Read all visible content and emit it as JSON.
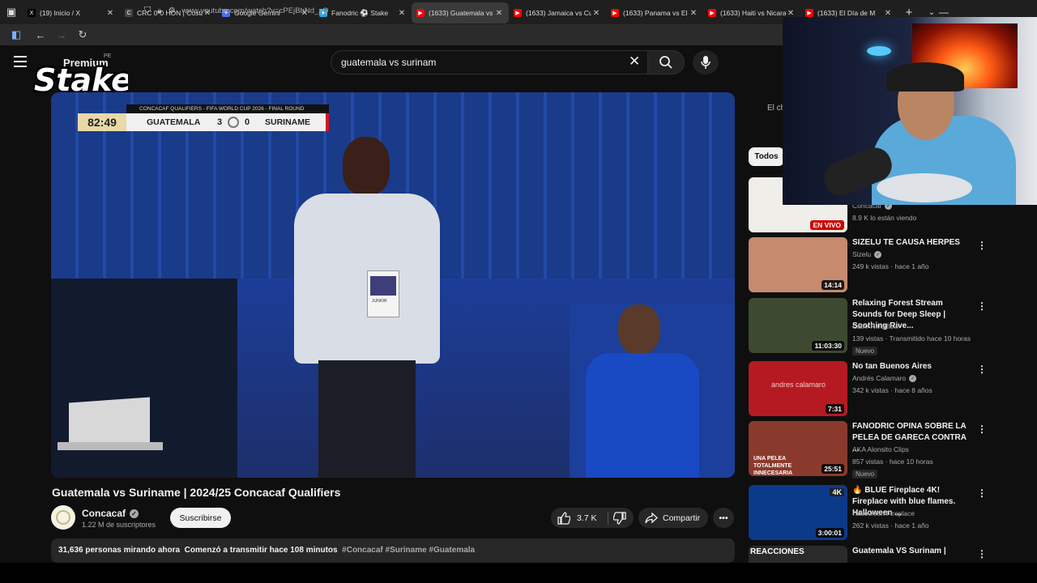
{
  "browser": {
    "tabs": [
      {
        "label": "(19) Inicio / X",
        "fav": "x-logo",
        "active": false
      },
      {
        "label": "CRC 0-0 HON | Costa R",
        "fav": "site",
        "active": false
      },
      {
        "label": "Google Gemini",
        "fav": "gemini",
        "active": false
      },
      {
        "label": "Fanodric ⚽ Stake",
        "fav": "telegram",
        "active": false
      },
      {
        "label": "(1633) Guatemala vs S",
        "fav": "youtube",
        "active": true
      },
      {
        "label": "(1633) Jamaica vs Cura",
        "fav": "youtube",
        "active": false
      },
      {
        "label": "(1633) Panama vs El Sa",
        "fav": "youtube",
        "active": false
      },
      {
        "label": "(1633) Haiti vs Nicarag",
        "fav": "youtube",
        "active": false
      },
      {
        "label": "(1633) El Día de M",
        "fav": "youtube",
        "active": false
      }
    ],
    "new_tab": "+",
    "url": "www.youtube.com/watch?v=cPEjBbNd_zQ"
  },
  "header": {
    "logo_text": "Premium",
    "logo_region": "PE",
    "search_value": "guatemala vs surinam",
    "stake_overlay": {
      "brand": "Stake",
      "suffix": ".pe"
    }
  },
  "player": {
    "scorebug": {
      "banner": "CONCACAF QUALIFIERS - FIFA WORLD CUP 2026 - FINAL ROUND",
      "clock": "82:49",
      "home": "GUATEMALA",
      "home_score": "3",
      "away_score": "0",
      "away": "SURINAME"
    },
    "lanyard_text": "JUNIOR"
  },
  "video": {
    "title": "Guatemala vs Suriname | 2024/25 Concacaf Qualifiers",
    "channel": "Concacaf",
    "subscribers": "1.22 M de suscriptores",
    "subscribe_label": "Suscribirse",
    "likes": "3.7 K",
    "share_label": "Compartir",
    "watching": "31,636 personas mirando ahora",
    "started": "Comenzó a transmitir hace 108 minutos",
    "hashtags": "#Concacaf #Suriname #Guatemala"
  },
  "sidebar": {
    "partial_text": "El ch",
    "chip_all": "Todos",
    "recommendations": [
      {
        "title": "",
        "channel": "Concacaf",
        "verified": true,
        "meta": "8.9 K lo están viendo",
        "badge": "",
        "overlay": "EN VIVO",
        "kind": "live",
        "thumb_color": "#f0eee8"
      },
      {
        "title": "SIZELU TE CAUSA HERPES",
        "channel": "Sizelu",
        "verified": true,
        "meta": "249 k vistas · hace 1 año",
        "badge": "",
        "overlay": "14:14",
        "kind": "dur",
        "thumb_color": "#c68a6e"
      },
      {
        "title": "Relaxing Forest Stream Sounds for Deep Sleep | Soothing Rive...",
        "channel": "Calm Riverflow",
        "verified": false,
        "meta": "139 vistas · Transmitido hace 10 horas",
        "badge": "Nuevo",
        "overlay": "11:03:30",
        "kind": "dur",
        "thumb_color": "#3d4a30"
      },
      {
        "title": "No tan Buenos Aires",
        "channel": "Andrés Calamaro",
        "verified": true,
        "meta": "342 k vistas · hace 8 años",
        "badge": "",
        "overlay": "7:31",
        "kind": "dur",
        "thumb_color": "#b51a22"
      },
      {
        "title": "FANODRIC OPINA SOBRE LA PELEA DE GARECA CONTRA ...",
        "channel": "AKA Alonsito Clips",
        "verified": false,
        "meta": "857 vistas · hace 10 horas",
        "badge": "Nuevo",
        "overlay": "25:51",
        "kind": "dur",
        "thumb_color": "#8a3a2c"
      },
      {
        "title": "🔥 BLUE Fireplace 4K! Fireplace with blue flames. Halloween ...",
        "channel": "Halloween Fireplace",
        "verified": false,
        "meta": "262 k vistas · hace 1 año",
        "badge": "",
        "overlay": "3:00:01",
        "kind": "dur",
        "thumb_color": "#0c3a8a"
      },
      {
        "title": "Guatemala VS Surinam |",
        "channel": "",
        "verified": false,
        "meta": "",
        "badge": "",
        "overlay": "",
        "kind": "none",
        "thumb_color": "#2a2a2a"
      }
    ],
    "thumb_texts": {
      "sizelu_time": "14:14",
      "calamaro_text": "andres calamaro",
      "aka_caption": "UNA PELEA TOTALMENTE INNECESARIA",
      "fireplace_badge": "4K",
      "last_caption": "REACCIONES"
    }
  },
  "colors": {
    "bg": "#0f0f0f",
    "accent_red": "#cc0000"
  }
}
